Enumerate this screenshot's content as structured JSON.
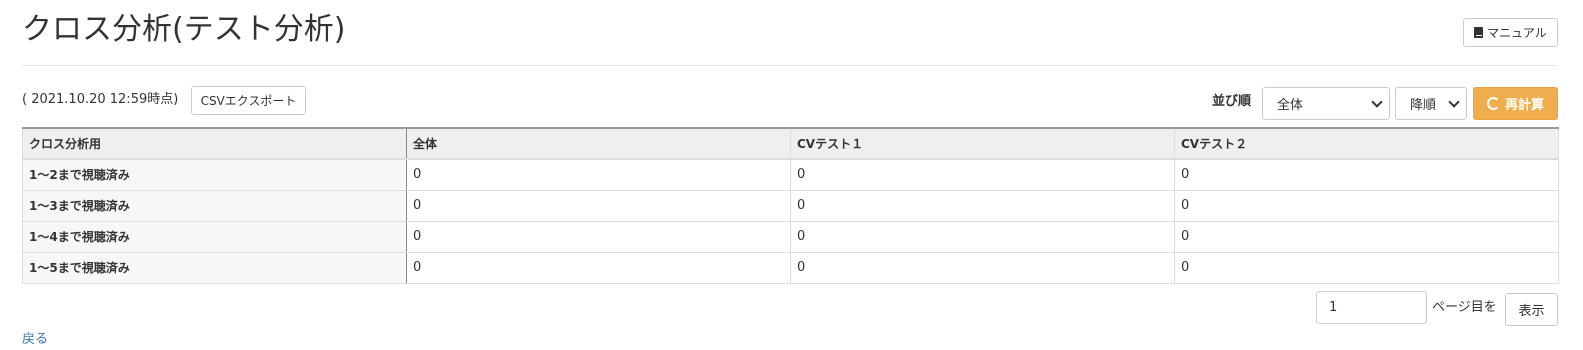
{
  "header": {
    "title": "クロス分析(テスト分析)",
    "manual_label": "マニュアル"
  },
  "toolbar": {
    "timestamp": "( 2021.10.20 12:59時点)",
    "csv_label": "CSVエクスポート",
    "sort_label": "並び順",
    "scope_value": "全体",
    "order_value": "降順",
    "recalc_label": "再計算"
  },
  "table": {
    "columns": [
      "クロス分析用",
      "全体",
      "CVテスト１",
      "CVテスト２"
    ],
    "rows": [
      {
        "label": "1〜2まで視聴済み",
        "values": [
          "0",
          "0",
          "0"
        ]
      },
      {
        "label": "1〜3まで視聴済み",
        "values": [
          "0",
          "0",
          "0"
        ]
      },
      {
        "label": "1〜4まで視聴済み",
        "values": [
          "0",
          "0",
          "0"
        ]
      },
      {
        "label": "1〜5まで視聴済み",
        "values": [
          "0",
          "0",
          "0"
        ]
      }
    ]
  },
  "pagination": {
    "page_value": "1",
    "suffix": "ページ目を",
    "show_label": "表示"
  },
  "footer": {
    "back_label": "戻る"
  },
  "colors": {
    "accent": "#f0ad4e",
    "link": "#337ab7"
  }
}
